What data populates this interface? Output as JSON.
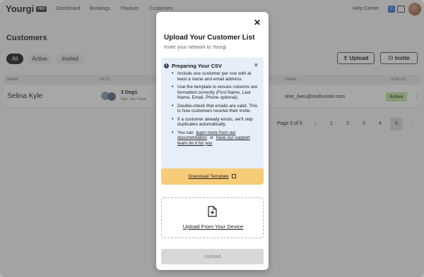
{
  "app": {
    "brand": "Yourgi",
    "brand_badge": "PRO",
    "nav": [
      "Dashboard",
      "Bookings",
      "Payouts",
      "Customers"
    ],
    "help": "Help Center",
    "notification_count": "2"
  },
  "page": {
    "title": "Customers",
    "filters": [
      "All",
      "Active",
      "Invited"
    ],
    "upload_label": "Upload",
    "invite_label": "Invite"
  },
  "table": {
    "headers": {
      "name": "NAME",
      "pets": "PETS",
      "email": "EMAIL",
      "status": "STATUS"
    },
    "row": {
      "name": "Selina Kyle",
      "pets_count": "3 Dogs",
      "pets_names": "Nyx, Jet, Pearl",
      "email": "nine_lives@roofrunner.com",
      "status": "Active"
    }
  },
  "pagination": {
    "label": "Page 5 of 5",
    "pages": [
      "1",
      "2",
      "3",
      "4",
      "5"
    ],
    "current": "5"
  },
  "modal": {
    "title": "Upload Your Customer List",
    "subtitle": "Invite your network to Yourgi.",
    "info": {
      "title": "Preparing Your CSV",
      "items": [
        "Include one customer per row with at least a name and email address.",
        "Use the template to ensure columns are formatted correctly (First Name, Last Name, Email, Phone optional).",
        "Double-check that emails are valid. This is how customers receive their invite.",
        "If a customer already exists, we'll skip duplicates automatically."
      ],
      "last_prefix": "You can",
      "last_link1": "learn more from our documentation",
      "last_mid": "or",
      "last_link2": "have our support team do it for you"
    },
    "download_label": "Download Template",
    "dropzone_label": "Upload From Your Device",
    "upload_button": "Upload"
  },
  "colors": {
    "info_bg": "#e5eef9",
    "download_bg": "#f7cc78",
    "status_bg": "#c4e7a6"
  }
}
